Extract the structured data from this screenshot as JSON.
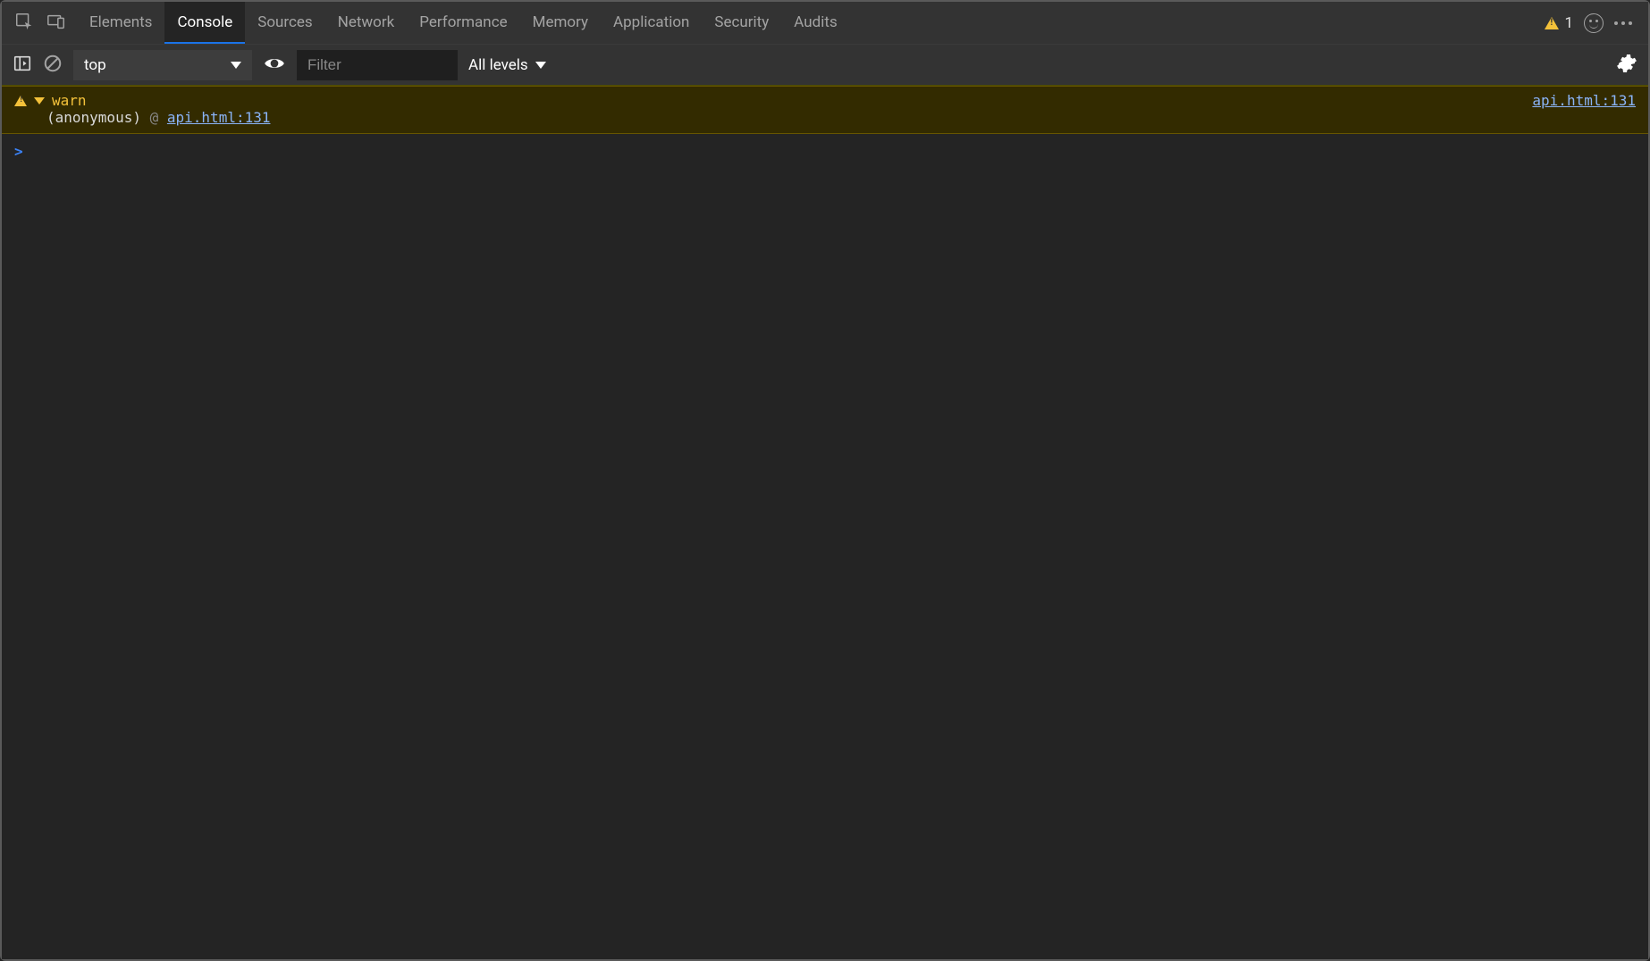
{
  "tabs": {
    "items": [
      "Elements",
      "Console",
      "Sources",
      "Network",
      "Performance",
      "Memory",
      "Application",
      "Security",
      "Audits"
    ],
    "active": "Console"
  },
  "status": {
    "warn_count": "1"
  },
  "toolbar": {
    "context": "top",
    "filter_placeholder": "Filter",
    "levels_label": "All levels"
  },
  "console": {
    "messages": [
      {
        "type": "warning",
        "text": "warn",
        "anonymous_label": "(anonymous)",
        "at": "@",
        "location": "api.html:131"
      }
    ],
    "prompt": ">"
  },
  "icons": {
    "inspect": "inspect-icon",
    "device": "device-icon",
    "smile": "smile-icon",
    "dots": "dots-icon",
    "sidebar": "sidebar-toggle-icon",
    "clear": "clear-console-icon",
    "eye": "live-expression-icon",
    "gear": "settings-icon"
  }
}
